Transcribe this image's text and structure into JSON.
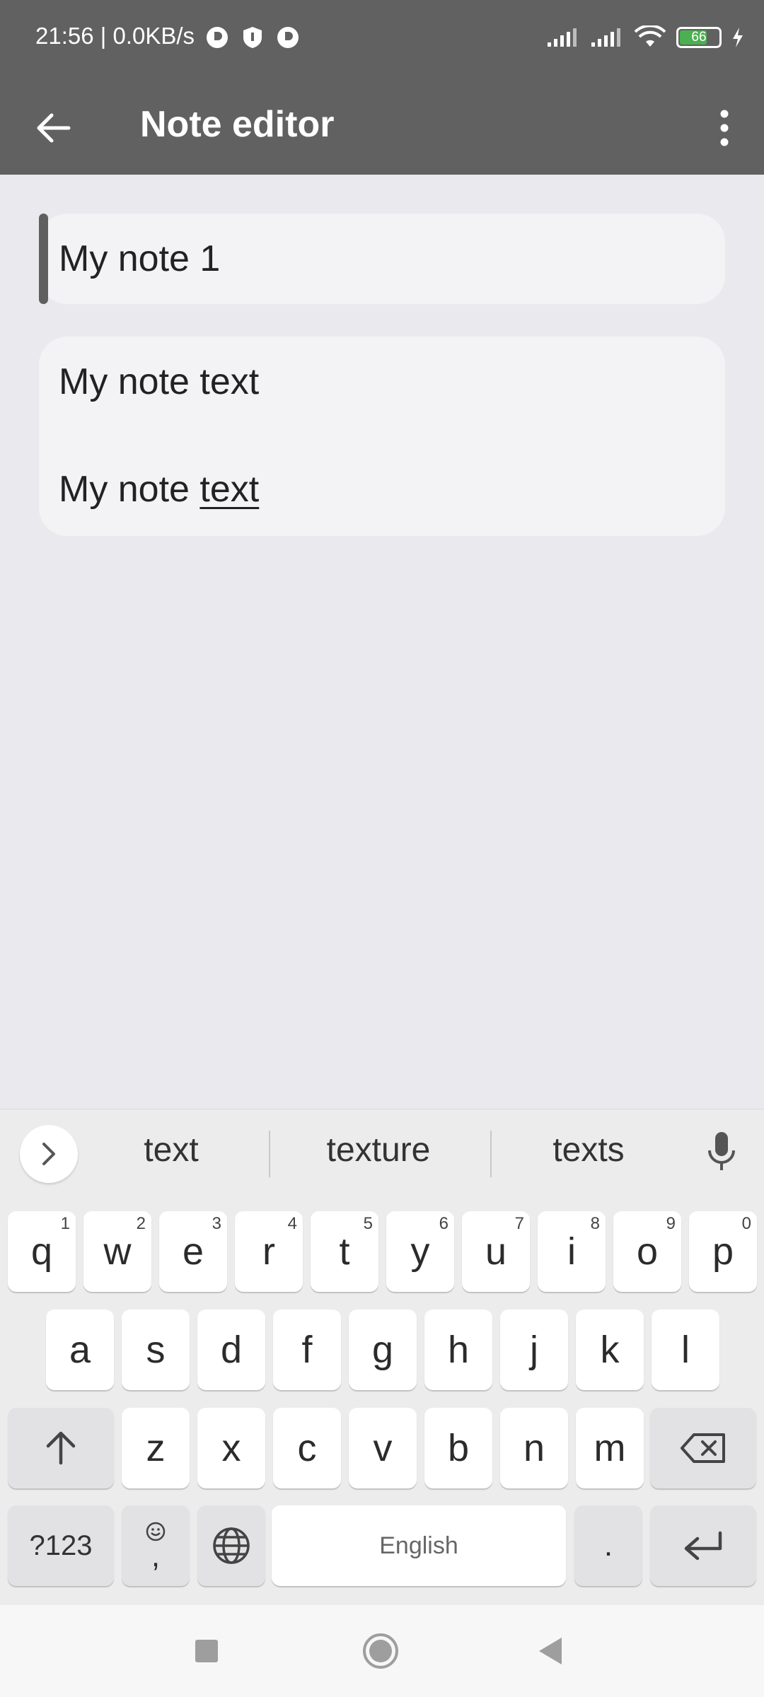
{
  "status_bar": {
    "time_speed": "21:56 | 0.0KB/s",
    "battery_level": "66",
    "icons": [
      "app-notification-icon",
      "shield-icon",
      "app-notification-icon",
      "signal-icon",
      "signal-icon",
      "wifi-icon",
      "battery-icon",
      "charging-icon"
    ]
  },
  "app_bar": {
    "title": "Note editor",
    "back_icon": "arrow-left-icon",
    "menu_icon": "more-vertical-icon"
  },
  "editor": {
    "title_value": "My note 1",
    "body_line1": "My note text",
    "body_line2_prefix": "My note ",
    "body_line2_underlined": "text"
  },
  "keyboard": {
    "suggestions": [
      "text",
      "texture",
      "texts"
    ],
    "row1": [
      {
        "key": "q",
        "hint": "1"
      },
      {
        "key": "w",
        "hint": "2"
      },
      {
        "key": "e",
        "hint": "3"
      },
      {
        "key": "r",
        "hint": "4"
      },
      {
        "key": "t",
        "hint": "5"
      },
      {
        "key": "y",
        "hint": "6"
      },
      {
        "key": "u",
        "hint": "7"
      },
      {
        "key": "i",
        "hint": "8"
      },
      {
        "key": "o",
        "hint": "9"
      },
      {
        "key": "p",
        "hint": "0"
      }
    ],
    "row2": [
      "a",
      "s",
      "d",
      "f",
      "g",
      "h",
      "j",
      "k",
      "l"
    ],
    "row3": [
      "z",
      "x",
      "c",
      "v",
      "b",
      "n",
      "m"
    ],
    "symbols_label": "?123",
    "comma_label": ",",
    "space_label": "English",
    "period_label": "."
  },
  "colors": {
    "app_bar": "#616161",
    "background": "#eaeaee",
    "field": "#f3f3f5"
  }
}
